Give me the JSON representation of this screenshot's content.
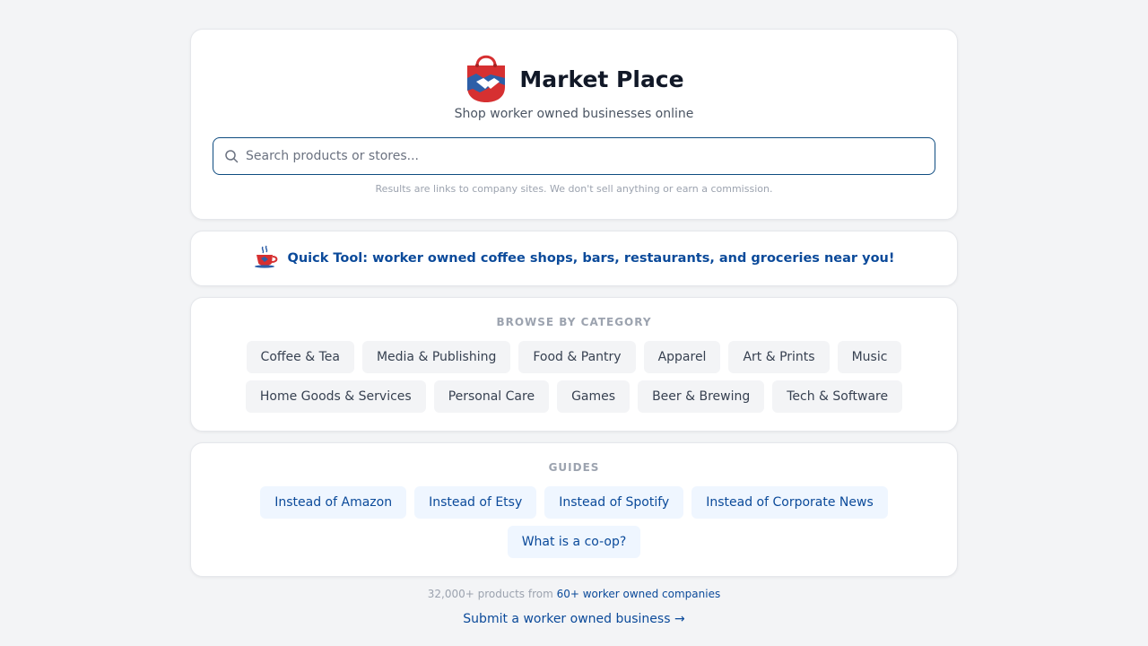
{
  "brand": {
    "title": "Market Place",
    "tagline": "Shop worker owned businesses online",
    "logo_icon": "shopping-bag-handshake-icon"
  },
  "search": {
    "placeholder": "Search products or stores...",
    "value": "",
    "disclaimer": "Results are links to company sites. We don't sell anything or earn a commission."
  },
  "quick_tool": {
    "label": "Quick Tool: worker owned coffee shops, bars, restaurants, and groceries near you!",
    "icon": "coffee-cup-icon"
  },
  "categories": {
    "title": "BROWSE BY CATEGORY",
    "items": [
      "Coffee & Tea",
      "Media & Publishing",
      "Food & Pantry",
      "Apparel",
      "Art & Prints",
      "Music",
      "Home Goods & Services",
      "Personal Care",
      "Games",
      "Beer & Brewing",
      "Tech & Software"
    ]
  },
  "guides": {
    "title": "GUIDES",
    "items": [
      "Instead of Amazon",
      "Instead of Etsy",
      "Instead of Spotify",
      "Instead of Corporate News",
      "What is a co-op?"
    ]
  },
  "footer": {
    "stats_prefix": "32,000+ products from ",
    "stats_link": "60+ worker owned companies",
    "submit_link": "Submit a worker owned business →"
  },
  "colors": {
    "accent": "#0b4a9a",
    "search_border": "#0f4c81",
    "logo_red": "#d63031",
    "logo_blue": "#2d5fa8"
  }
}
